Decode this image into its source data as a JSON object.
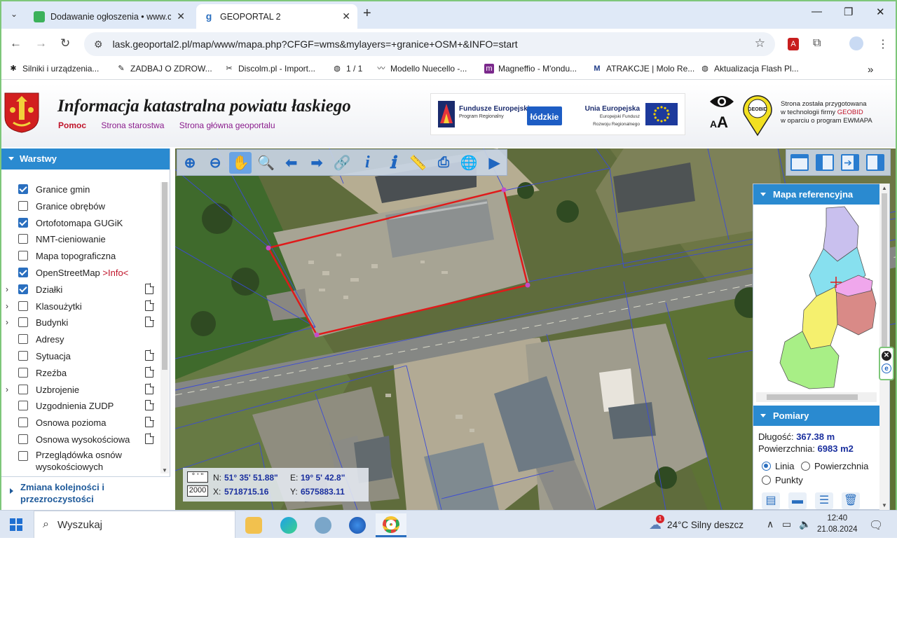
{
  "browser": {
    "tabs": [
      {
        "title": "Dodawanie ogłoszenia • www.c",
        "active": false
      },
      {
        "title": "GEOPORTAL 2",
        "active": true
      }
    ],
    "url": "lask.geoportal2.pl/map/www/mapa.php?CFGF=wms&mylayers=+granice+OSM+&INFO=start",
    "bookmarks": [
      "Silniki i urządzenia...",
      "ZADBAJ O ZDROW...",
      "Discolm.pl - Import...",
      "1 / 1",
      "Modello Nuecello -...",
      "Magneffio - M'ondu...",
      "ATRAKCJE | Molo Re...",
      "Aktualizacja Flash Pl..."
    ]
  },
  "header": {
    "title": "Informacja katastralna powiatu łaskiego",
    "links": [
      "Pomoc",
      "Strona starostwa",
      "Strona główna geoportalu"
    ],
    "eu": {
      "fe_title": "Fundusze Europejskie",
      "fe_sub": "Program Regionalny",
      "lodz": "łódzkie",
      "ue_title": "Unia Europejska",
      "ue_sub": "Europejski Fundusz Rozwoju Regionalnego"
    },
    "font_size_label": "AA",
    "geobid_label": "GEOBID",
    "geobid_text": [
      "Strona została przygotowana",
      "w technologii firmy ",
      "GEOBID",
      "w oparciu o program EWMAPA"
    ]
  },
  "left_panel": {
    "title": "Warstwy",
    "layers": [
      {
        "label": "Granice gmin",
        "checked": true,
        "expandable": false,
        "doc": false
      },
      {
        "label": "Granice obrębów",
        "checked": false,
        "expandable": false,
        "doc": false
      },
      {
        "label": "Ortofotomapa GUGiK",
        "checked": true,
        "expandable": false,
        "doc": false
      },
      {
        "label": "NMT-cieniowanie",
        "checked": false,
        "expandable": false,
        "doc": false
      },
      {
        "label": "Mapa topograficzna",
        "checked": false,
        "expandable": false,
        "doc": false
      },
      {
        "label": "OpenStreetMap",
        "info": ">Info<",
        "checked": true,
        "expandable": false,
        "doc": false
      },
      {
        "label": "Działki",
        "checked": true,
        "expandable": true,
        "doc": true
      },
      {
        "label": "Klasoużytki",
        "checked": false,
        "expandable": true,
        "doc": true
      },
      {
        "label": "Budynki",
        "checked": false,
        "expandable": true,
        "doc": true
      },
      {
        "label": "Adresy",
        "checked": false,
        "expandable": false,
        "doc": false
      },
      {
        "label": "Sytuacja",
        "checked": false,
        "expandable": false,
        "doc": true
      },
      {
        "label": "Rzeźba",
        "checked": false,
        "expandable": false,
        "doc": true
      },
      {
        "label": "Uzbrojenie",
        "checked": false,
        "expandable": true,
        "doc": true
      },
      {
        "label": "Uzgodnienia ZUDP",
        "checked": false,
        "expandable": false,
        "doc": true
      },
      {
        "label": "Osnowa pozioma",
        "checked": false,
        "expandable": false,
        "doc": true
      },
      {
        "label": "Osnowa wysokościowa",
        "checked": false,
        "expandable": false,
        "doc": true
      },
      {
        "label": "Przeglądówka osnów wysokościowych",
        "checked": false,
        "expandable": false,
        "doc": false
      }
    ],
    "order_title": "Zmiana kolejności i przezroczystości"
  },
  "toolbar": {
    "tools": [
      "zoom-in-icon",
      "zoom-out-icon",
      "pan-hand-icon",
      "zoom-box-icon",
      "back-arrow-icon",
      "forward-arrow-icon",
      "link-icon",
      "info-icon",
      "info-plus-icon",
      "measure-icon",
      "print-icon",
      "globe-icon",
      "camera-icon"
    ],
    "selected": "pan-hand-icon"
  },
  "right_panel": {
    "refmap_title": "Mapa referencyjna",
    "pomiary_title": "Pomiary",
    "length_label": "Długość: ",
    "length_value": "367.38 m",
    "area_label": "Powierzchnia: ",
    "area_value": "6983 m2",
    "modes": [
      {
        "label": "Linia",
        "selected": true
      },
      {
        "label": "Powierzchnia",
        "selected": false
      },
      {
        "label": "Punkty",
        "selected": false
      }
    ]
  },
  "coords": {
    "format_btn": "° ' \"",
    "system_btn": "2000",
    "n_label": "N:",
    "n_value": "51° 35' 51.88\"",
    "e_label": "E:",
    "e_value": "19° 5' 42.8\"",
    "x_label": "X:",
    "x_value": "5718715.16",
    "y_label": "Y:",
    "y_value": "6575883.11"
  },
  "taskbar": {
    "search_placeholder": "Wyszukaj",
    "weather": "24°C  Silny deszcz",
    "weather_badge": "1",
    "time": "12:40",
    "date": "21.08.2024"
  },
  "colors": {
    "accent": "#2a8ad0",
    "parcel": "#e01a1a",
    "link": "#8a1c8c",
    "value": "#1a2f9e"
  }
}
